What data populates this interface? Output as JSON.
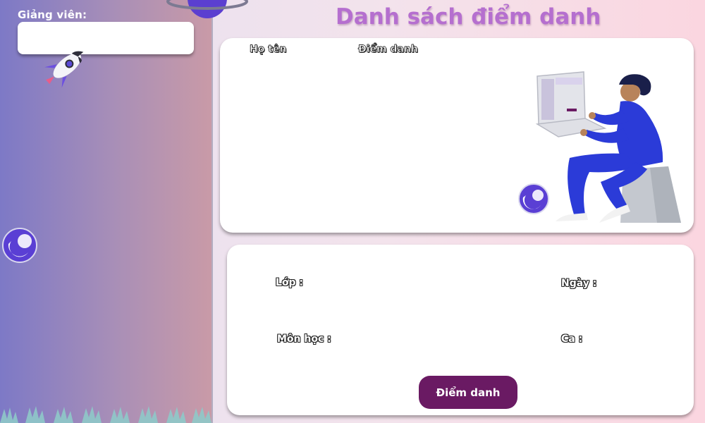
{
  "sidebar": {
    "lecturer_label": "Giảng viên:",
    "lecturer_value": ""
  },
  "main": {
    "title": "Danh sách điểm danh",
    "table": {
      "columns": [
        "Họ tên",
        "Điểm danh"
      ],
      "rows": []
    },
    "info": {
      "class_label": "Lớp :",
      "date_label": "Ngày :",
      "subject_label": "Môn học :",
      "shift_label": "Ca :"
    },
    "attend_button_label": "Điểm danh"
  },
  "colors": {
    "sidebar_gradient": [
      "#7d79c6",
      "#c99aa7"
    ],
    "title": "#b56fcf",
    "button": "#6a1a63",
    "card": "#ffffff"
  },
  "icons": [
    "rocket-icon",
    "planet-icon",
    "grass-decoration",
    "person-laptop-illustration"
  ]
}
